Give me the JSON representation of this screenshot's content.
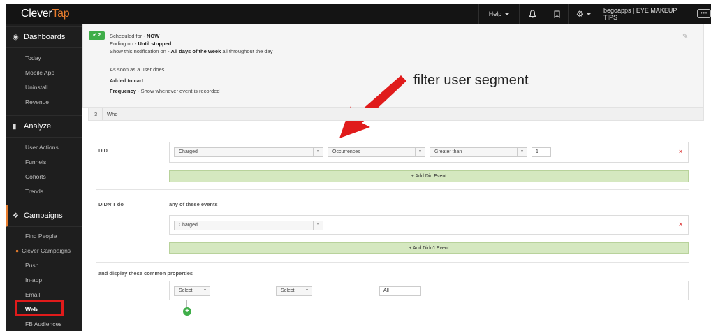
{
  "topbar": {
    "logo_clever": "Clever",
    "logo_tap": "Tap",
    "help_label": "Help",
    "account_label": "begoapps | EYE MAKEUP TIPS",
    "more_label": "•••",
    "icons": [
      "bell-icon",
      "bookmark-icon",
      "gear-icon"
    ]
  },
  "sidebar": {
    "dashboards": {
      "label": "Dashboards",
      "items": [
        "Today",
        "Mobile App",
        "Uninstall",
        "Revenue"
      ]
    },
    "analyze": {
      "label": "Analyze",
      "items": [
        "User Actions",
        "Funnels",
        "Cohorts",
        "Trends"
      ]
    },
    "campaigns": {
      "label": "Campaigns",
      "items": [
        "Find People",
        "Clever Campaigns",
        "Push",
        "In-app",
        "Email",
        "Web",
        "FB Audiences"
      ]
    }
  },
  "schedule": {
    "badge": "✔ 2",
    "line1_prefix": "Scheduled for - ",
    "line1_value": "NOW",
    "line2_prefix": "Ending on - ",
    "line2_value": "Until stopped",
    "line3_prefix": "Show this notification on - ",
    "line3_value": "All days of the week",
    "line3_suffix": " all throughout the day",
    "line4": "As soon as a user does",
    "line5": "Added to cart",
    "line6_prefix": "Frequency",
    "line6_suffix": " - Show whenever event is recorded"
  },
  "annotation": "filter user segment",
  "who": {
    "number": "3",
    "label": "Who"
  },
  "did": {
    "label": "DID",
    "event": "Charged",
    "metric": "Occurrences",
    "operator": "Greater than",
    "value": "1",
    "add_label": "+ Add Did Event"
  },
  "didnt": {
    "label": "DIDN'T do",
    "qualifier": "any of these events",
    "event": "Charged",
    "add_label": "+ Add Didn't Event"
  },
  "properties": {
    "label": "and display these common properties",
    "select1": "Select",
    "select2": "Select",
    "value": "All"
  },
  "colors": {
    "accent": "#e87d2e",
    "highlight_box": "#e01b1b",
    "badge_green": "#3fae49",
    "add_bar": "#d5e8c0"
  }
}
